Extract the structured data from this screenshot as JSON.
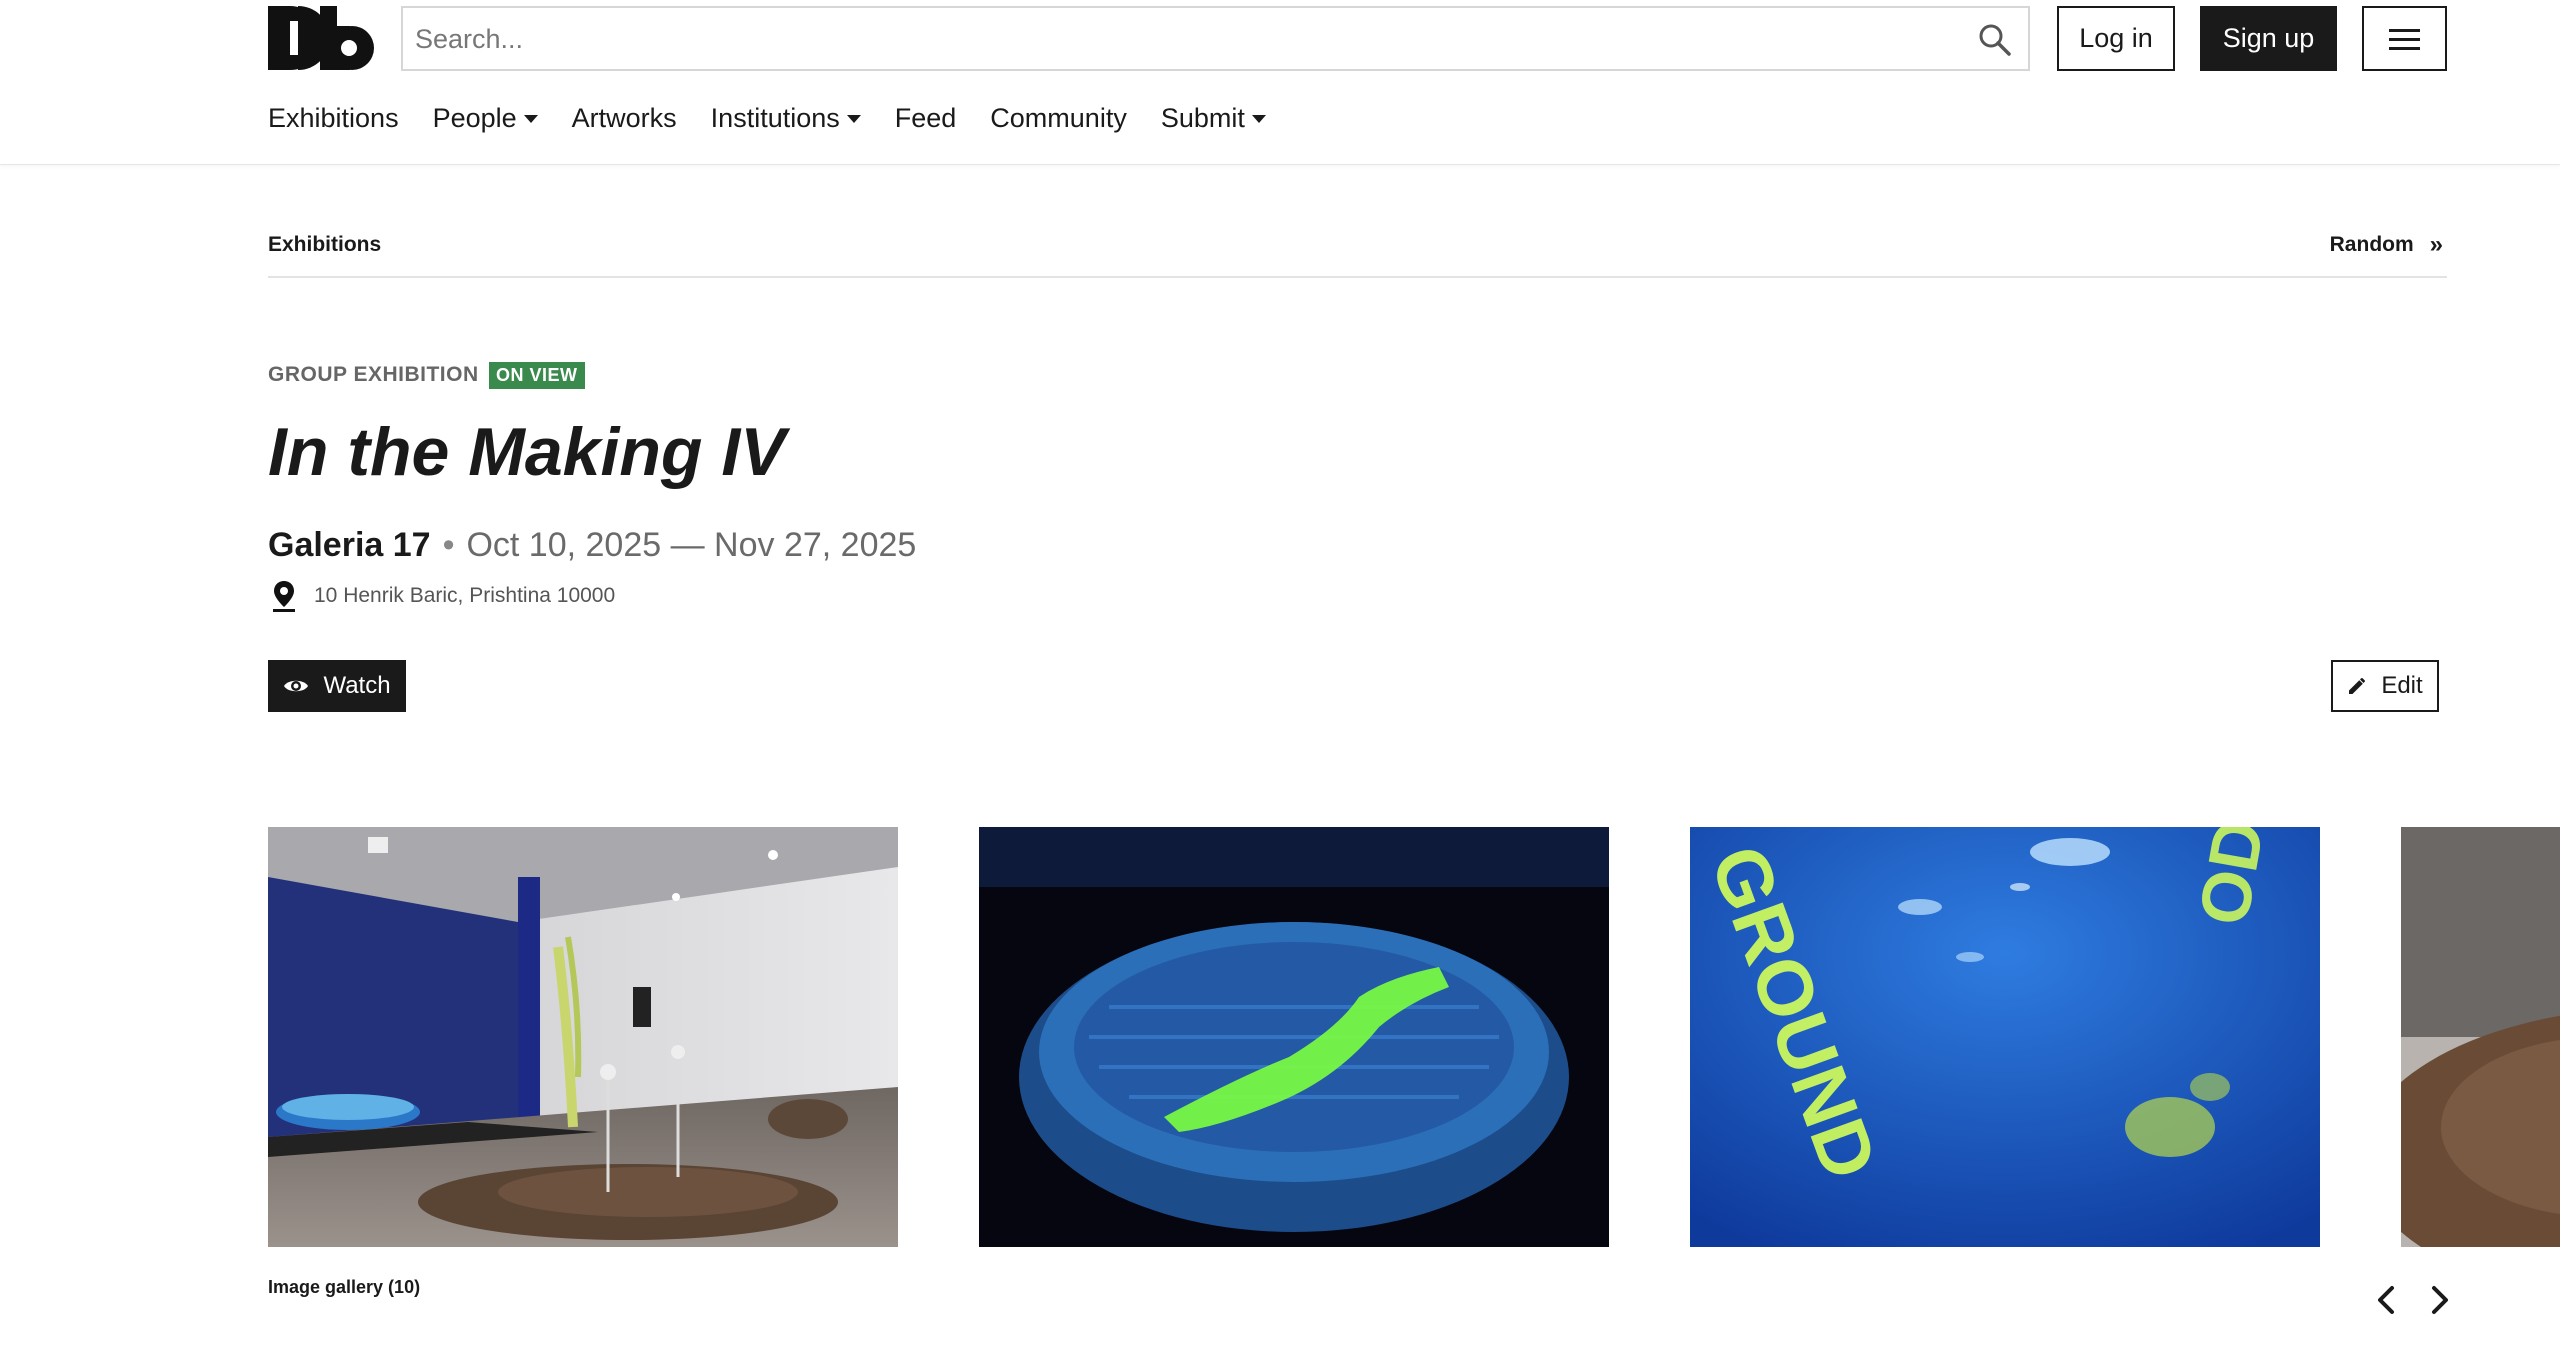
{
  "header": {
    "logo_text": "Db",
    "search": {
      "placeholder": "Search...",
      "value": ""
    },
    "login_label": "Log in",
    "signup_label": "Sign up",
    "nav": [
      {
        "label": "Exhibitions",
        "dropdown": false
      },
      {
        "label": "People",
        "dropdown": true
      },
      {
        "label": "Artworks",
        "dropdown": false
      },
      {
        "label": "Institutions",
        "dropdown": true
      },
      {
        "label": "Feed",
        "dropdown": false
      },
      {
        "label": "Community",
        "dropdown": false
      },
      {
        "label": "Submit",
        "dropdown": true
      }
    ]
  },
  "breadcrumb": {
    "label": "Exhibitions",
    "random_label": "Random",
    "random_icon": "»"
  },
  "exhibition": {
    "type": "GROUP EXHIBITION",
    "status_badge": "ON VIEW",
    "status_color": "#3a8a4d",
    "title": "In the Making IV",
    "venue": "Galeria 17",
    "separator": "•",
    "dates": "Oct 10, 2025 — Nov 27, 2025",
    "address": "10 Henrik Baric, Prishtina 10000"
  },
  "actions": {
    "watch_label": "Watch",
    "edit_label": "Edit"
  },
  "gallery": {
    "caption": "Image gallery (10)",
    "image_3_text": "GROUND"
  }
}
